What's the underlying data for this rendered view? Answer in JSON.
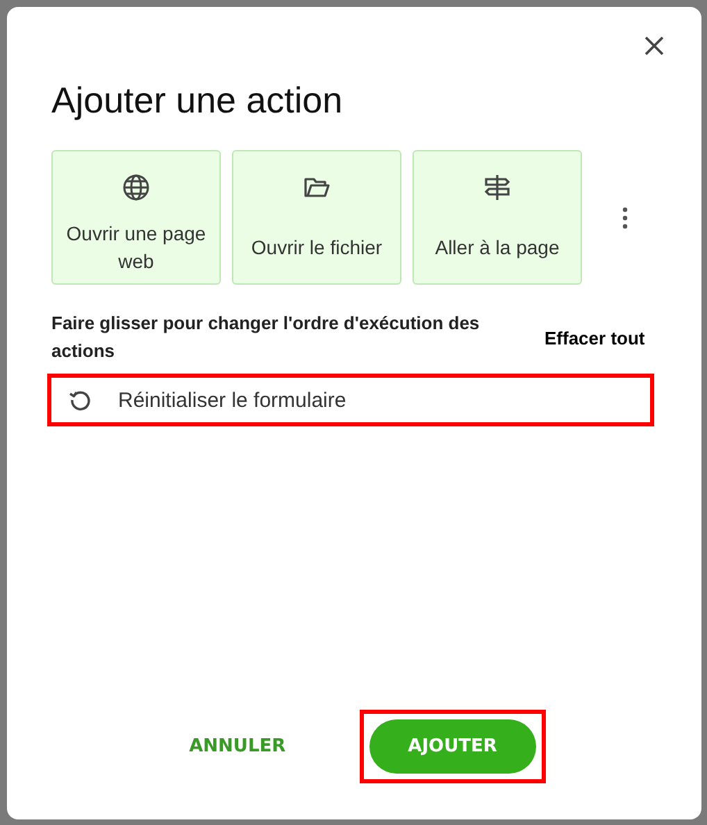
{
  "dialog": {
    "title": "Ajouter une action",
    "tiles": [
      {
        "kind": "globe",
        "label": "Ouvrir une page web"
      },
      {
        "kind": "folder",
        "label": "Ouvrir le fichier"
      },
      {
        "kind": "signpost",
        "label": "Aller à la page"
      }
    ],
    "hint": "Faire glisser pour changer l'ordre d'exécution des actions",
    "clear_all": "Effacer tout",
    "actions": [
      {
        "label": "Réinitialiser le formulaire",
        "highlighted": true
      }
    ],
    "buttons": [
      {
        "label": "ANNULER",
        "kind": "text",
        "highlighted": false
      },
      {
        "label": "AJOUTER",
        "kind": "primary",
        "highlighted": true
      }
    ]
  }
}
